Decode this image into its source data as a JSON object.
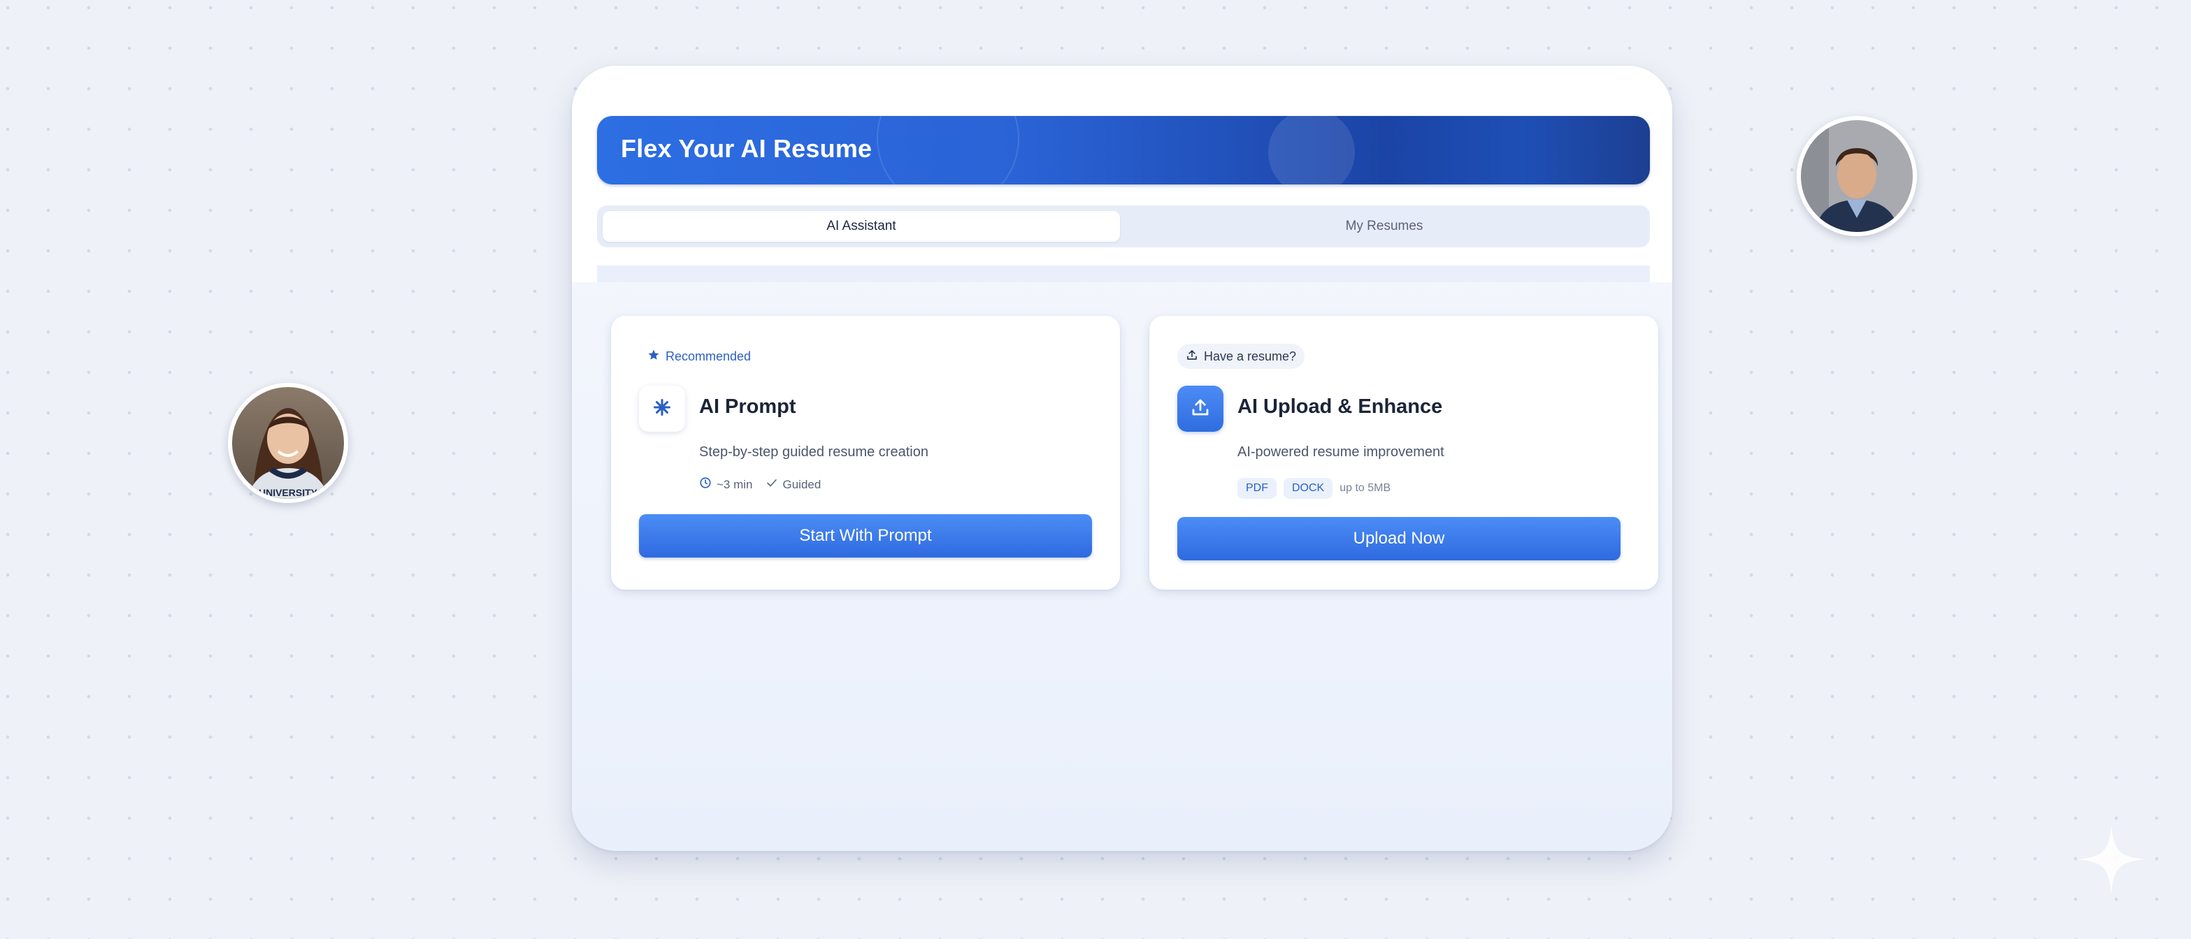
{
  "header": {
    "title": "Flex Your AI Resume"
  },
  "tabs": [
    {
      "label": "AI Assistant",
      "active": true
    },
    {
      "label": "My Resumes",
      "active": false
    }
  ],
  "cards": {
    "prompt": {
      "chip": "Recommended",
      "chip_icon": "star-icon",
      "icon": "sparkle-icon",
      "title": "AI Prompt",
      "description": "Step-by-step guided resume creation",
      "meta_time": "~3 min",
      "meta_guided": "Guided",
      "button": "Start With Prompt"
    },
    "upload": {
      "chip": "Have a resume?",
      "chip_icon": "upload-icon",
      "icon": "upload-icon",
      "title": "AI Upload & Enhance",
      "description": "AI-powered resume improvement",
      "tags": [
        "PDF",
        "DOCK"
      ],
      "size_note": "up to 5MB",
      "button": "Upload Now"
    }
  },
  "colors": {
    "accent": "#2f6de0",
    "banner_dark": "#1b44a6",
    "background": "#eef1f7"
  }
}
